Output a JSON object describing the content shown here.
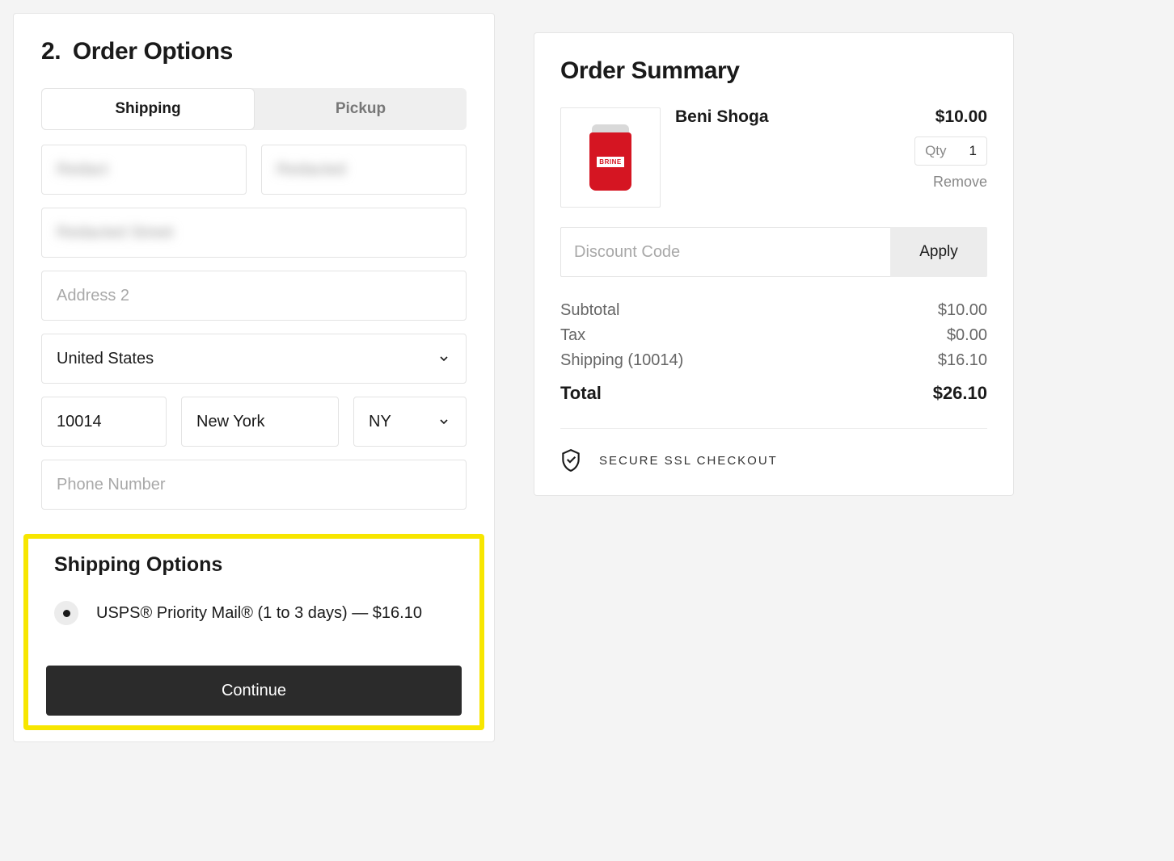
{
  "orderOptions": {
    "title": "2. Order Options",
    "tabs": {
      "shipping": "Shipping",
      "pickup": "Pickup"
    },
    "fields": {
      "firstName": "Redact",
      "lastName": "Redacted",
      "address1": "Redacted Street",
      "address2Placeholder": "Address 2",
      "country": "United States",
      "zip": "10014",
      "city": "New York",
      "state": "NY",
      "phonePlaceholder": "Phone Number"
    },
    "shippingOptions": {
      "title": "Shipping Options",
      "option1": "USPS® Priority Mail® (1 to 3 days) — $16.10"
    },
    "continue": "Continue"
  },
  "summary": {
    "title": "Order Summary",
    "item": {
      "name": "Beni Shoga",
      "price": "$10.00",
      "qtyLabel": "Qty",
      "qtyValue": "1",
      "remove": "Remove",
      "jarLabel": "BRINE"
    },
    "discount": {
      "placeholder": "Discount Code",
      "apply": "Apply"
    },
    "lines": {
      "subtotalLabel": "Subtotal",
      "subtotalValue": "$10.00",
      "taxLabel": "Tax",
      "taxValue": "$0.00",
      "shippingLabel": "Shipping (10014)",
      "shippingValue": "$16.10",
      "totalLabel": "Total",
      "totalValue": "$26.10"
    },
    "ssl": "SECURE SSL CHECKOUT"
  }
}
